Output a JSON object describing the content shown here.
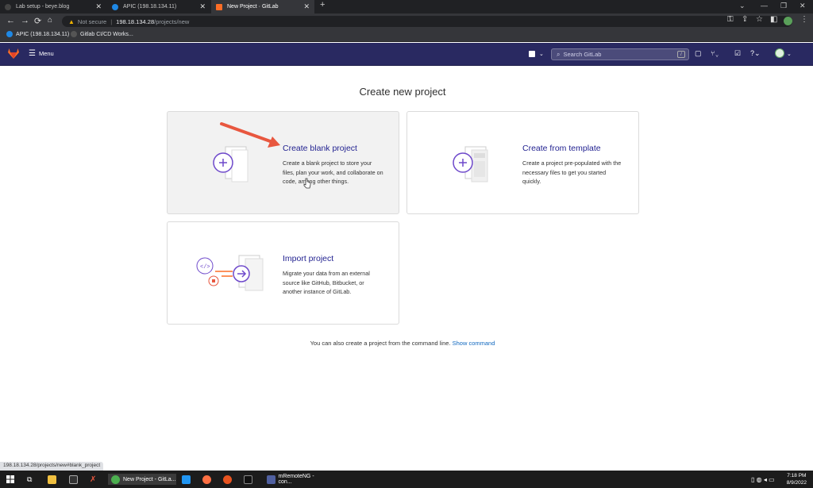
{
  "browser": {
    "tabs": [
      {
        "label": "Lab setup - beye.blog",
        "active": false
      },
      {
        "label": "APIC (198.18.134.11)",
        "active": false
      },
      {
        "label": "New Project · GitLab",
        "active": true
      }
    ],
    "address": {
      "not_secure": "Not secure",
      "host": "198.18.134.28",
      "path": "/projects/new"
    },
    "bookmarks": [
      {
        "label": "APIC (198.18.134.11)"
      },
      {
        "label": "Gitlab CI/CD Works..."
      }
    ]
  },
  "gitlab": {
    "menu_label": "Menu",
    "search_placeholder": "Search GitLab",
    "search_shortcut": "/"
  },
  "page": {
    "title": "Create new project",
    "cards": {
      "blank": {
        "title": "Create blank project",
        "description": "Create a blank project to store your files, plan your work, and collaborate on code, among other things."
      },
      "template": {
        "title": "Create from template",
        "description": "Create a project pre-populated with the necessary files to get you started quickly."
      },
      "import": {
        "title": "Import project",
        "description": "Migrate your data from an external source like GitHub, Bitbucket, or another instance of GitLab."
      }
    },
    "cli_note": "You can also create a project from the command line.",
    "cli_link": "Show command"
  },
  "status_url": "198.18.134.28/projects/new#blank_project",
  "taskbar": {
    "items": [
      {
        "label": "New Project - GitLa..."
      },
      {
        "label": "mRemoteNG - con..."
      }
    ],
    "time": "7:18 PM",
    "date": "8/9/2022"
  },
  "colors": {
    "gitlab_header": "#292961",
    "link_blue": "#1068bf",
    "card_title": "#1f1f8f",
    "accent_purple": "#6e49cb",
    "arrow_red": "#e8573f"
  }
}
